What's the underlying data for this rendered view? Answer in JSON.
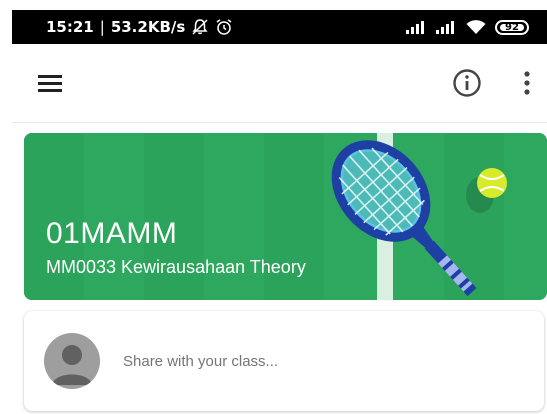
{
  "status_bar": {
    "time": "15:21",
    "separator": "|",
    "network_speed": "53.2KB/s",
    "battery": "92",
    "icons": [
      "muted-bell-icon",
      "alarm-icon",
      "signal-1-icon",
      "signal-2-icon",
      "wifi-icon",
      "battery-icon"
    ]
  },
  "app_bar": {
    "icons": [
      "hamburger-menu-icon",
      "info-icon",
      "more-vert-icon"
    ]
  },
  "class_banner": {
    "class_name": "01MAMM",
    "subtitle": "MM0033 Kewirausahaan Theory",
    "theme_color": "#2fa85f",
    "illustration": "tennis-racket-and-ball"
  },
  "share_box": {
    "placeholder": "Share with your class..."
  },
  "colors": {
    "banner_green": "#2fa85f",
    "racket_blue": "#1e3fa3",
    "ball_yellow": "#d7ea2c",
    "status_bar_bg": "#000000"
  }
}
